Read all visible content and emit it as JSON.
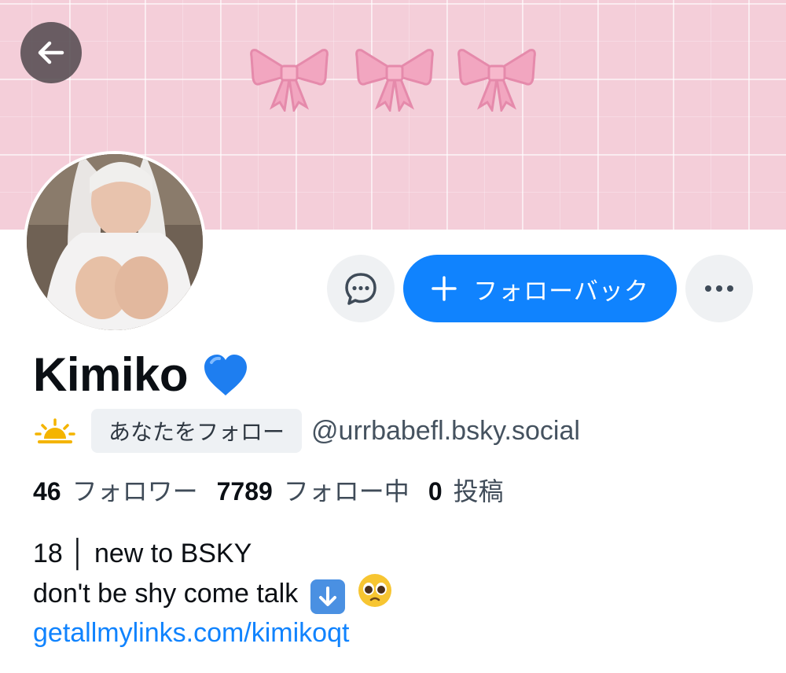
{
  "header": {
    "back_icon": "arrow-left-icon"
  },
  "actions": {
    "message_icon": "chat-bubble-icon",
    "follow_back_label": "フォローバック",
    "more_icon": "ellipsis-icon"
  },
  "profile": {
    "display_name": "Kimiko",
    "name_emoji": "blue-heart-icon",
    "status_emoji": "sunrise-icon",
    "follows_you_label": "あなたをフォロー",
    "handle": "@urrbabefl.bsky.social"
  },
  "stats": {
    "followers_count": "46",
    "followers_label": "フォロワー",
    "following_count": "7789",
    "following_label": "フォロー中",
    "posts_count": "0",
    "posts_label": "投稿"
  },
  "bio": {
    "line1": "18 │ new to BSKY",
    "line2": "don't be shy come talk",
    "link": "getallmylinks.com/kimikoqt"
  },
  "colors": {
    "accent": "#1083fe",
    "banner": "#f4ced9",
    "bow": "#f2a6c0"
  }
}
